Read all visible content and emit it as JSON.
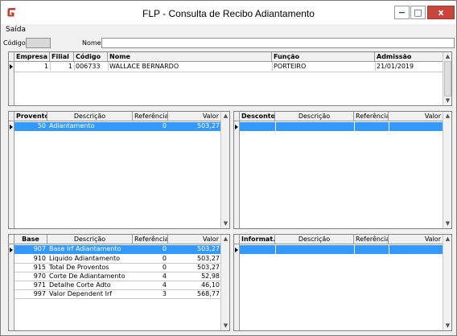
{
  "window": {
    "title": "FLP - Consulta de Recibo Adiantamento",
    "controls": {
      "minimize": "−",
      "maximize": "□",
      "close": "x"
    }
  },
  "menu": {
    "items": [
      {
        "label": "Saída"
      }
    ]
  },
  "filters": {
    "codigo_label": "Código",
    "codigo_value": "",
    "nome_label": "Nome",
    "nome_value": ""
  },
  "employees": {
    "columns": [
      "Empresa",
      "Filial",
      "Código",
      "Nome",
      "Função",
      "Admissão"
    ],
    "rows": [
      {
        "empresa": "1",
        "filial": "1",
        "codigo": "006733",
        "nome": "WALLACE BERNARDO",
        "funcao": "PORTEIRO",
        "admissao": "21/01/2019"
      }
    ]
  },
  "proventos": {
    "columns": [
      "Provento",
      "Descrição",
      "Referência",
      "Valor"
    ],
    "rows": [
      {
        "code": "50",
        "descricao": "Adiantamento",
        "referencia": "0",
        "valor": "503,27"
      }
    ]
  },
  "descontos": {
    "columns": [
      "Desconto",
      "Descrição",
      "Referência",
      "Valor"
    ],
    "rows": []
  },
  "bases": {
    "columns": [
      "Base",
      "Descrição",
      "Referência",
      "Valor"
    ],
    "rows": [
      {
        "code": "907",
        "descricao": "Base Irf Adiantamento",
        "referencia": "0",
        "valor": "503,27"
      },
      {
        "code": "910",
        "descricao": "Liquido Adiantamento",
        "referencia": "0",
        "valor": "503,27"
      },
      {
        "code": "915",
        "descricao": "Total De Proventos",
        "referencia": "0",
        "valor": "503,27"
      },
      {
        "code": "970",
        "descricao": "Corte De Adiantamento",
        "referencia": "4",
        "valor": "52,98"
      },
      {
        "code": "971",
        "descricao": "Detalhe Corte Adto",
        "referencia": "4",
        "valor": "46,10"
      },
      {
        "code": "997",
        "descricao": "Valor Dependent Irf",
        "referencia": "3",
        "valor": "568,77"
      }
    ]
  },
  "informativos": {
    "columns": [
      "Informat.",
      "Descrição",
      "Referência",
      "Valor"
    ],
    "rows": []
  },
  "colors": {
    "selection": "#3399ff",
    "close_button": "#c9463d",
    "app_icon": "#c0392b"
  },
  "icons": {
    "app": "flp-logo-icon",
    "scroll_up": "▲",
    "scroll_down": "▼"
  }
}
